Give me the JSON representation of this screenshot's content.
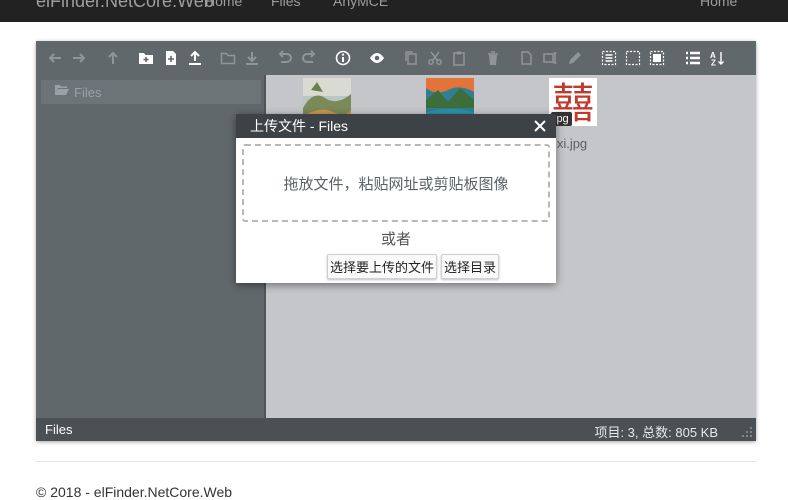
{
  "navbar": {
    "brand": "elFinder.NetCore.Web",
    "links": [
      "Home",
      "Files",
      "AnyMCE"
    ],
    "right_link": "Home"
  },
  "toolbar": {
    "icons": [
      "back-icon",
      "forward-icon",
      "up-icon",
      "new-folder-icon",
      "new-file-icon",
      "upload-icon",
      "open-folder-icon",
      "download-icon",
      "undo-icon",
      "redo-icon",
      "info-icon",
      "preview-icon",
      "copy-icon",
      "cut-icon",
      "paste-icon",
      "delete-icon",
      "duplicate-icon",
      "rename-icon",
      "edit-icon",
      "select-all-icon",
      "select-none-icon",
      "select-invert-icon",
      "list-view-icon",
      "sort-icon"
    ]
  },
  "tree": {
    "root": "Files"
  },
  "files": [
    {
      "name": "",
      "badge": ""
    },
    {
      "name": "",
      "badge": ""
    },
    {
      "name": "xi.jpg",
      "badge": "jpg"
    }
  ],
  "status": {
    "path": "Files",
    "stats": "项目: 3,    总数: 805 KB"
  },
  "dialog": {
    "title": "上传文件 - Files",
    "dropzone": "拖放文件，粘贴网址或剪贴板图像",
    "or": "或者",
    "select_files": "选择要上传的文件",
    "select_folder": "选择目录"
  },
  "footer": {
    "text": "© 2018 - elFinder.NetCore.Web"
  },
  "colors": {
    "navbar": "#222222",
    "toolbar": "#61686c",
    "content_bg": "#c5c6c9",
    "statusbar": "#4b5054",
    "dialog_title": "#3d4246"
  }
}
